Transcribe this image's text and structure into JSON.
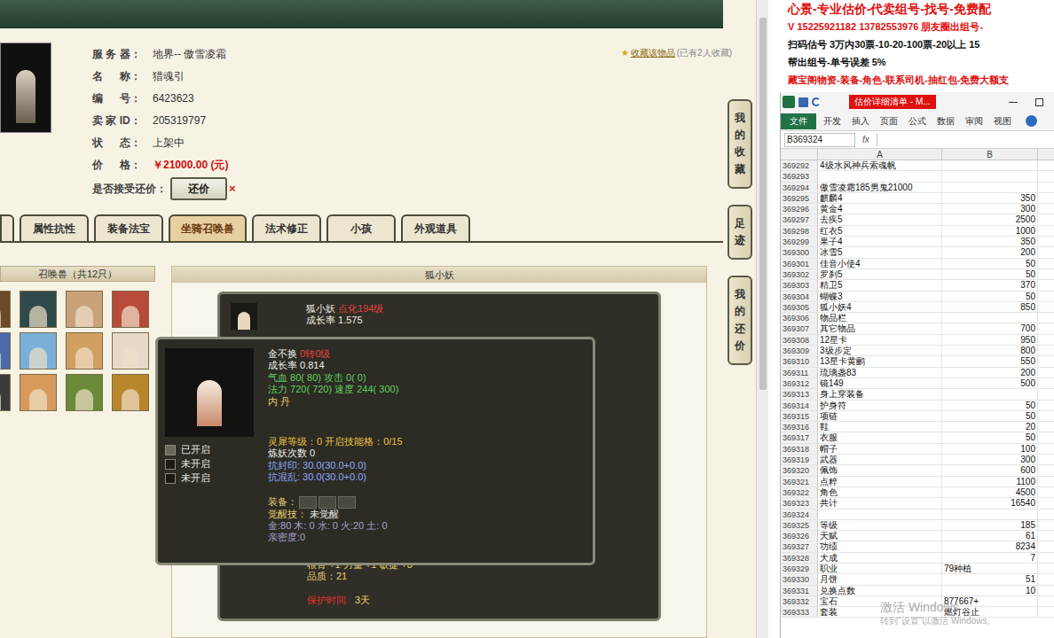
{
  "game_page": {
    "info": [
      {
        "label": "服 务 器：",
        "value": "地界-- 傲雪凌霜",
        "kind": "plain"
      },
      {
        "label": "名 　 称：",
        "value": "猎魂引",
        "kind": "plain"
      },
      {
        "label": "编 　 号：",
        "value": "6423623",
        "kind": "plain"
      },
      {
        "label": "卖 家 ID：",
        "value": "205319797",
        "kind": "plain"
      },
      {
        "label": "状 　 态：",
        "value": "上架中",
        "kind": "plain"
      },
      {
        "label": "价 　 格：",
        "value": "￥21000.00 (元)",
        "kind": "price"
      }
    ],
    "bargain_label": "是否接受还价：",
    "bargain_button": "还价",
    "bargain_close": "×",
    "collect_link": "收藏该物品",
    "collect_count": "(已有2人收藏)",
    "tabs": [
      {
        "label": "属性抗性",
        "selected": false
      },
      {
        "label": "装备法宝",
        "selected": false
      },
      {
        "label": "坐骑召唤兽",
        "selected": true
      },
      {
        "label": "法术修正",
        "selected": false
      },
      {
        "label": "小孩",
        "selected": false
      },
      {
        "label": "外观道具",
        "selected": false
      }
    ],
    "pet_panel": {
      "title": "召唤兽（共12只）",
      "pets": [
        {
          "color": "#6b4a2a"
        },
        {
          "color": "#2e4a4a"
        },
        {
          "color": "#c9a27a"
        },
        {
          "color": "#b84a3a"
        },
        {
          "color": "#4a6aa8"
        },
        {
          "color": "#7ab0d8"
        },
        {
          "color": "#d0a060"
        },
        {
          "color": "#e8d8c8"
        },
        {
          "color": "#3a3a3a"
        },
        {
          "color": "#d89a5a"
        },
        {
          "color": "#6a8a3a"
        },
        {
          "color": "#b8862a"
        }
      ]
    },
    "pet_detail": {
      "header": "狐小妖",
      "name": "狐小妖",
      "level": "点化194级",
      "growth": "成长率 1.575",
      "attrs": "根骨 +1 力量 +1 敏捷 +3",
      "quality": "品质：21",
      "protect_label": "保护时间",
      "protect_value": "3天"
    },
    "side_nav": [
      "我的收藏",
      "足迹",
      "我的还价"
    ],
    "tooltip": {
      "name": "金不换",
      "level": "0转0级",
      "growth": "成长率 0.814",
      "hp": "气血 80( 80) 攻击 0( 0)",
      "mp": "法力 720( 720) 速度 244( 300)",
      "neidan": "内 丹",
      "lingxi": "灵犀等级：0 开启技能格：0/15",
      "lianyao": "炼妖次数 0",
      "resist1": "抗封印: 30.0(30.0+0.0)",
      "resist2": "抗混乱: 30.0(30.0+0.0)",
      "equip": "装备：",
      "awaken_label": "觉醒技：",
      "awaken_value": "未觉醒",
      "elements": "金:80 木: 0 水: 0 火:20 土: 0",
      "intimacy": "亲密度:0",
      "slots": [
        {
          "label": "已开启",
          "on": true
        },
        {
          "label": "未开启",
          "on": false
        },
        {
          "label": "未开启",
          "on": false
        }
      ]
    }
  },
  "ad_lines": [
    {
      "text": "心景-专业估价-代卖组号-找号-免费配",
      "color": "#e01010"
    },
    {
      "text": "V 15225921182   13782553976 朋友圈出组号-",
      "color": "#e01010"
    },
    {
      "text": "扫码估号 3万内30票-10-20-100票-20以上 15",
      "color": "#111111"
    },
    {
      "text": "帮出组号-单号误差 5%",
      "color": "#111111"
    },
    {
      "text": "藏宝阁物资-装备-角色-联系司机-抽红包-免费大额支",
      "color": "#e01010"
    }
  ],
  "excel": {
    "title": "估价详细清单 - M...",
    "ribbon": [
      "文件",
      "开发",
      "插入",
      "页面",
      "公式",
      "数据",
      "审阅",
      "视图"
    ],
    "name_box": "B369324",
    "fx": "fx",
    "columns": [
      "A",
      "B"
    ],
    "rows": [
      {
        "n": "369292",
        "a": "4级水风神兵索魂帆",
        "b": "",
        "kind": "number"
      },
      {
        "n": "369293",
        "a": "",
        "b": "",
        "kind": "number"
      },
      {
        "n": "369294",
        "a": "傲雪凌霜185男鬼21000",
        "b": "",
        "kind": "number"
      },
      {
        "n": "369295",
        "a": "麒麟4",
        "b": "350",
        "kind": "number"
      },
      {
        "n": "369296",
        "a": "黄金4",
        "b": "300",
        "kind": "number"
      },
      {
        "n": "369297",
        "a": "去疾5",
        "b": "2500",
        "kind": "number"
      },
      {
        "n": "369298",
        "a": "红衣5",
        "b": "1000",
        "kind": "number"
      },
      {
        "n": "369299",
        "a": "果子4",
        "b": "350",
        "kind": "number"
      },
      {
        "n": "369300",
        "a": "冰雪5",
        "b": "200",
        "kind": "number"
      },
      {
        "n": "369301",
        "a": "佳音小使4",
        "b": "50",
        "kind": "number"
      },
      {
        "n": "369302",
        "a": "罗刹5",
        "b": "50",
        "kind": "number"
      },
      {
        "n": "369303",
        "a": "精卫5",
        "b": "370",
        "kind": "number"
      },
      {
        "n": "369304",
        "a": "蝴蝶3",
        "b": "50",
        "kind": "number"
      },
      {
        "n": "369305",
        "a": "狐小妖4",
        "b": "850",
        "kind": "number"
      },
      {
        "n": "369306",
        "a": "物品栏",
        "b": "",
        "kind": "number"
      },
      {
        "n": "369307",
        "a": "其它物品",
        "b": "700",
        "kind": "number"
      },
      {
        "n": "369308",
        "a": "12星卡",
        "b": "950",
        "kind": "number"
      },
      {
        "n": "369309",
        "a": "3级步定",
        "b": "800",
        "kind": "number"
      },
      {
        "n": "369310",
        "a": "13星卡黄鹂",
        "b": "550",
        "kind": "number"
      },
      {
        "n": "369311",
        "a": "琉璃盏83",
        "b": "200",
        "kind": "number"
      },
      {
        "n": "369312",
        "a": "镜149",
        "b": "500",
        "kind": "number"
      },
      {
        "n": "369313",
        "a": "身上穿装备",
        "b": "",
        "kind": "number"
      },
      {
        "n": "369314",
        "a": "护身符",
        "b": "50",
        "kind": "number"
      },
      {
        "n": "369315",
        "a": "项链",
        "b": "50",
        "kind": "number"
      },
      {
        "n": "369316",
        "a": "鞋",
        "b": "20",
        "kind": "number"
      },
      {
        "n": "369317",
        "a": "衣服",
        "b": "50",
        "kind": "number"
      },
      {
        "n": "369318",
        "a": "帽子",
        "b": "100",
        "kind": "number"
      },
      {
        "n": "369319",
        "a": "武器",
        "b": "300",
        "kind": "number"
      },
      {
        "n": "369320",
        "a": "佩饰",
        "b": "600",
        "kind": "number"
      },
      {
        "n": "369321",
        "a": "点粹",
        "b": "1100",
        "kind": "number"
      },
      {
        "n": "369322",
        "a": "角色",
        "b": "4500",
        "kind": "number"
      },
      {
        "n": "369323",
        "a": "共计",
        "b": "16540",
        "kind": "number"
      },
      {
        "n": "369324",
        "a": "",
        "b": "",
        "kind": "number"
      },
      {
        "n": "369325",
        "a": "等级",
        "b": "185",
        "kind": "number"
      },
      {
        "n": "369326",
        "a": "天赋",
        "b": "61",
        "kind": "number"
      },
      {
        "n": "369327",
        "a": "功绩",
        "b": "8234",
        "kind": "number"
      },
      {
        "n": "369328",
        "a": "大成",
        "b": "7",
        "kind": "number"
      },
      {
        "n": "369329",
        "a": "职业",
        "b": "79种植",
        "kind": "text"
      },
      {
        "n": "369330",
        "a": "月饼",
        "b": "51",
        "kind": "number"
      },
      {
        "n": "369331",
        "a": "兑换点数",
        "b": "10",
        "kind": "number"
      },
      {
        "n": "369332",
        "a": "宝石",
        "b": "877667+",
        "kind": "text"
      },
      {
        "n": "369333",
        "a": "套装",
        "b": "燃灯谷止",
        "kind": "text"
      }
    ]
  },
  "watermark": {
    "title": "激活 Windows",
    "subtitle": "转到\"设置\"以激活 Windows。"
  }
}
